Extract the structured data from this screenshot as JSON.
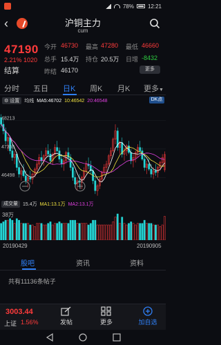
{
  "status": {
    "battery": "78%",
    "time": "12:21"
  },
  "header": {
    "title": "沪铜主力",
    "subtitle": "cum"
  },
  "quote": {
    "price": "47190",
    "change": "2.21% 1020",
    "state": "结算",
    "open_label": "今开",
    "open_value": "46730",
    "high_label": "最高",
    "high_value": "47280",
    "low_label": "最低",
    "low_value": "46660",
    "vol_label": "总手",
    "vol_value": "15.4万",
    "oi_label": "持仓",
    "oi_value": "20.5万",
    "daily_label": "日增",
    "daily_value": "-8432",
    "prev_label": "昨结",
    "prev_value": "46170",
    "more_label": "更多"
  },
  "tabs": [
    {
      "label": "分时"
    },
    {
      "label": "五日"
    },
    {
      "label": "日K"
    },
    {
      "label": "周K"
    },
    {
      "label": "月K"
    },
    {
      "label": "更多"
    }
  ],
  "ma_bar": {
    "settings_label": "设置",
    "avg_label": "均线",
    "ma5": "MA5:46702",
    "ma10": "10:46542",
    "ma20": "20:46548",
    "dk_label": "DK点"
  },
  "chart_data": {
    "type": "candlestick",
    "y_tick_labels": [
      "48213",
      "47355",
      "46498"
    ],
    "ylim": [
      45900,
      48600
    ],
    "x_start_label": "20190429",
    "x_end_label": "20190905",
    "colors": {
      "up": "#ff3b3b",
      "down": "#25d4d4",
      "ma5": "#ffffff",
      "ma10": "#f0e040",
      "ma20": "#e040e0"
    },
    "note_candles": "approximate daily OHLC read from chart",
    "candles": [
      [
        48300,
        48400,
        48000,
        48100
      ],
      [
        48100,
        48250,
        47800,
        47900
      ],
      [
        47900,
        48000,
        47500,
        47600
      ],
      [
        47600,
        47800,
        47300,
        47700
      ],
      [
        47700,
        47750,
        47200,
        47300
      ],
      [
        47300,
        47500,
        47000,
        47100
      ],
      [
        47100,
        47300,
        46900,
        47200
      ],
      [
        47200,
        47250,
        46700,
        46800
      ],
      [
        46800,
        47000,
        46500,
        46600
      ],
      [
        46600,
        46800,
        46400,
        46700
      ],
      [
        46700,
        46900,
        46500,
        46550
      ],
      [
        46550,
        46700,
        46300,
        46400
      ],
      [
        46400,
        46600,
        46200,
        46500
      ],
      [
        46500,
        46700,
        46350,
        46450
      ],
      [
        46450,
        46650,
        46300,
        46600
      ],
      [
        46600,
        46800,
        46500,
        46750
      ],
      [
        46750,
        47000,
        46600,
        46900
      ],
      [
        46900,
        47200,
        46800,
        47100
      ],
      [
        47100,
        47300,
        46900,
        47000
      ],
      [
        47000,
        47200,
        46850,
        47150
      ],
      [
        47150,
        47400,
        47050,
        47300
      ],
      [
        47300,
        47500,
        47100,
        47200
      ],
      [
        47200,
        47350,
        46900,
        47000
      ],
      [
        47000,
        47250,
        46900,
        47200
      ],
      [
        47200,
        47500,
        47100,
        47400
      ],
      [
        47400,
        47600,
        47200,
        47300
      ],
      [
        47300,
        47400,
        46950,
        47050
      ],
      [
        47050,
        47200,
        46800,
        46900
      ],
      [
        46900,
        47100,
        46700,
        47000
      ],
      [
        47000,
        47300,
        46900,
        47250
      ],
      [
        47250,
        47400,
        47000,
        47100
      ],
      [
        47100,
        47200,
        46700,
        46800
      ],
      [
        46800,
        46900,
        46400,
        46500
      ],
      [
        46500,
        46700,
        46200,
        46300
      ],
      [
        46300,
        46500,
        46100,
        46400
      ],
      [
        46400,
        46600,
        46200,
        46350
      ],
      [
        46350,
        46550,
        46150,
        46500
      ],
      [
        46500,
        46800,
        46400,
        46700
      ],
      [
        46700,
        47000,
        46600,
        46900
      ],
      [
        46900,
        47100,
        46750,
        46850
      ],
      [
        46850,
        47000,
        46600,
        46700
      ],
      [
        46700,
        46800,
        46300,
        46400
      ],
      [
        46400,
        46500,
        46000,
        46100
      ],
      [
        46100,
        46300,
        45950,
        46250
      ],
      [
        46250,
        46500,
        46150,
        46450
      ],
      [
        46450,
        46700,
        46350,
        46650
      ],
      [
        46650,
        46900,
        46550,
        46800
      ],
      [
        46800,
        47000,
        46650,
        46900
      ],
      [
        46900,
        47200,
        46850,
        47150
      ],
      [
        47150,
        47400,
        47050,
        47300
      ],
      [
        47300,
        47700,
        47250,
        47650
      ],
      [
        47650,
        48100,
        47500,
        47900
      ],
      [
        47900,
        48000,
        47300,
        47400
      ],
      [
        47400,
        47600,
        47200,
        47550
      ],
      [
        47550,
        47700,
        47100,
        47200
      ],
      [
        47200,
        47400,
        47000,
        47300
      ],
      [
        47300,
        47500,
        47150,
        47450
      ],
      [
        47450,
        47600,
        47200,
        47250
      ],
      [
        47250,
        47350,
        46900,
        47000
      ],
      [
        47000,
        47200,
        46800,
        47100
      ],
      [
        47100,
        47300,
        46950,
        47250
      ],
      [
        47250,
        47500,
        47100,
        47400
      ],
      [
        47400,
        47600,
        47200,
        47300
      ],
      [
        47300,
        47400,
        47000,
        47050
      ],
      [
        47050,
        47200,
        46700,
        46800
      ],
      [
        46800,
        47000,
        46600,
        46900
      ],
      [
        46900,
        47100,
        46700,
        46750
      ],
      [
        46750,
        46900,
        46500,
        46600
      ],
      [
        46600,
        46800,
        46450,
        46700
      ],
      [
        46700,
        46900,
        46550,
        46650
      ],
      [
        46650,
        46850,
        46500,
        46800
      ],
      [
        46800,
        47000,
        46700,
        46950
      ],
      [
        46950,
        47200,
        46850,
        47100
      ],
      [
        46730,
        47280,
        46660,
        47190
      ]
    ]
  },
  "volume_bar": {
    "label": "成交量",
    "vol": "15.4万",
    "ma1": "MA1:13.1万",
    "ma2": "MA2:13.1万",
    "max_label": "38万"
  },
  "lower_tabs": [
    {
      "label": "股吧"
    },
    {
      "label": "资讯"
    },
    {
      "label": "资料"
    }
  ],
  "post_count": "共有11136条帖子",
  "bottom": {
    "index_value": "3003.44",
    "index_name": "上证",
    "index_pct": "1.56%",
    "post_label": "发帖",
    "more_label": "更多",
    "watch_label": "加自选"
  }
}
